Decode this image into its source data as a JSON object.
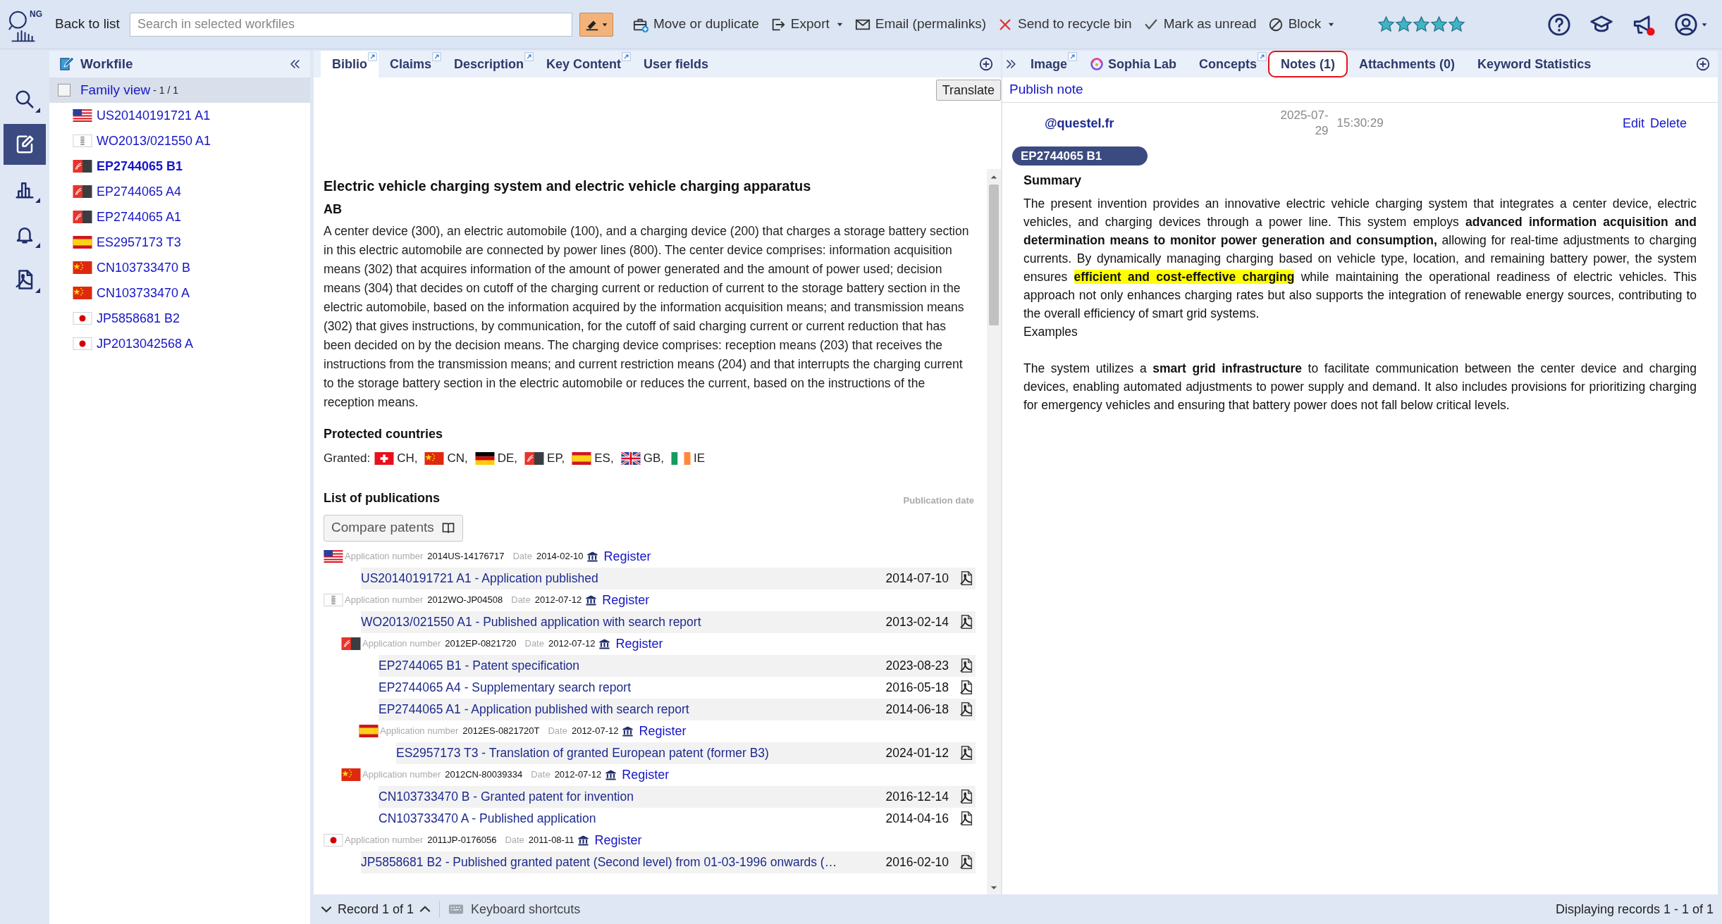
{
  "topbar": {
    "logo_text": "NG",
    "back": "Back to list",
    "search": {
      "placeholder": "Search in selected workfiles"
    },
    "actions": [
      {
        "kind": "move",
        "label": "Move or duplicate",
        "dropdown": false
      },
      {
        "kind": "export",
        "label": "Export",
        "dropdown": true
      },
      {
        "kind": "email",
        "label": "Email (permalinks)",
        "dropdown": false
      },
      {
        "kind": "recycle",
        "label": "Send to recycle bin",
        "dropdown": false
      },
      {
        "kind": "unread",
        "label": "Mark as unread",
        "dropdown": false
      },
      {
        "kind": "block",
        "label": "Block",
        "dropdown": true
      }
    ],
    "rating": {
      "stars": 5
    },
    "announcements_badge": true
  },
  "rail": [
    {
      "kind": "search",
      "selected": false
    },
    {
      "kind": "edit",
      "selected": true
    },
    {
      "kind": "chart",
      "selected": false
    },
    {
      "kind": "bell",
      "selected": false
    },
    {
      "kind": "pdf",
      "selected": false
    }
  ],
  "workfile": {
    "title": "Workfile",
    "family_view": {
      "label": "Family view",
      "count": "- 1 / 1",
      "checked": false
    },
    "items": [
      {
        "kind": "us",
        "label": "US20140191721 A1",
        "selected": false
      },
      {
        "kind": "wo",
        "label": "WO2013/021550 A1",
        "selected": false
      },
      {
        "kind": "ep",
        "label": "EP2744065 B1",
        "selected": true
      },
      {
        "kind": "ep",
        "label": "EP2744065 A4",
        "selected": false
      },
      {
        "kind": "ep",
        "label": "EP2744065 A1",
        "selected": false
      },
      {
        "kind": "es",
        "label": "ES2957173 T3",
        "selected": false
      },
      {
        "kind": "cn",
        "label": "CN103733470 B",
        "selected": false
      },
      {
        "kind": "cn",
        "label": "CN103733470 A",
        "selected": false
      },
      {
        "kind": "jp",
        "label": "JP5858681 B2",
        "selected": false
      },
      {
        "kind": "jp",
        "label": "JP2013042568 A",
        "selected": false
      }
    ]
  },
  "middle": {
    "tabs": [
      {
        "label": "Biblio",
        "selected": true,
        "popout": true
      },
      {
        "label": "Claims",
        "selected": false,
        "popout": true
      },
      {
        "label": "Description",
        "selected": false,
        "popout": true
      },
      {
        "label": "Key Content",
        "selected": false,
        "popout": true
      },
      {
        "label": "User fields",
        "selected": false,
        "popout": false
      }
    ],
    "translate": "Translate",
    "title": "Electric vehicle charging system and electric vehicle charging apparatus",
    "abstract_label": "AB",
    "abstract": "A center device (300), an electric automobile (100), and a charging device (200) that charges a storage battery section in this electric automobile are connected by power lines (800). The center device comprises: information acquisition means (302) that acquires information of the amount of power generated and the amount of power used; decision means (304) that decides on cutoff of the charging current or reduction of current to the storage battery section in the electric automobile, based on the information acquired by the information acquisition means; and transmission means (302) that gives instructions, by communication, for the cutoff of said charging current or current reduction that has been decided on by the decision means. The charging device comprises: reception means (203) that receives the instructions from the transmission means; and current restriction means (204) and that interrupts the charging current to the storage battery section in the electric automobile or reduces the current, based on the instructions of the reception means.",
    "protected": {
      "heading": "Protected countries",
      "label": "Granted:",
      "countries": [
        {
          "kind": "ch",
          "code": "CH,"
        },
        {
          "kind": "cn",
          "code": "CN,"
        },
        {
          "kind": "de",
          "code": "DE,"
        },
        {
          "kind": "ep",
          "code": "EP,"
        },
        {
          "kind": "es",
          "code": "ES,"
        },
        {
          "kind": "gb",
          "code": "GB,"
        },
        {
          "kind": "ie",
          "code": "IE"
        }
      ]
    },
    "publications": {
      "heading": "List of publications",
      "date_heading": "Publication date",
      "compare": "Compare patents",
      "applications": [
        {
          "kind": "us",
          "number_label": "Application number",
          "number": "2014US-14176717",
          "date_label": "Date",
          "date": "2014-02-10",
          "register": "Register",
          "publications": [
            {
              "title": "US20140191721 A1 - Application published",
              "date": "2014-07-10"
            }
          ]
        },
        {
          "kind": "wo",
          "number_label": "Application number",
          "number": "2012WO-JP04508",
          "date_label": "Date",
          "date": "2012-07-12",
          "register": "Register",
          "publications": [
            {
              "title": "WO2013/021550 A1 - Published application with search report",
              "date": "2013-02-14"
            }
          ],
          "children": [
            {
              "kind": "ep",
              "number_label": "Application number",
              "number": "2012EP-0821720",
              "date_label": "Date",
              "date": "2012-07-12",
              "register": "Register",
              "publications": [
                {
                  "title": "EP2744065 B1 - Patent specification",
                  "date": "2023-08-23"
                },
                {
                  "title": "EP2744065 A4 - Supplementary search report",
                  "date": "2016-05-18"
                },
                {
                  "title": "EP2744065 A1 - Application published with search report",
                  "date": "2014-06-18"
                }
              ],
              "children": [
                {
                  "kind": "es",
                  "number_label": "Application number",
                  "number": "2012ES-0821720T",
                  "date_label": "Date",
                  "date": "2012-07-12",
                  "register": "Register",
                  "publications": [
                    {
                      "title": "ES2957173 T3 - Translation of granted European patent (former B3)",
                      "date": "2024-01-12"
                    }
                  ]
                }
              ]
            },
            {
              "kind": "cn",
              "number_label": "Application number",
              "number": "2012CN-80039334",
              "date_label": "Date",
              "date": "2012-07-12",
              "register": "Register",
              "publications": [
                {
                  "title": "CN103733470 B - Granted patent for invention",
                  "date": "2016-12-14"
                },
                {
                  "title": "CN103733470 A - Published application",
                  "date": "2014-04-16"
                }
              ]
            }
          ]
        },
        {
          "kind": "jp",
          "number_label": "Application number",
          "number": "2011JP-0176056",
          "date_label": "Date",
          "date": "2011-08-11",
          "register": "Register",
          "publications": [
            {
              "title": "JP5858681 B2 - Published granted patent (Second level) from 01-03-1996 onwards (…",
              "date": "2016-02-10"
            }
          ]
        }
      ]
    }
  },
  "right": {
    "tabs": [
      {
        "label": "Image",
        "selected": false,
        "popout": true,
        "kind": "plain"
      },
      {
        "label": "Sophia Lab",
        "selected": false,
        "popout": false,
        "kind": "sophia"
      },
      {
        "label": "Concepts",
        "selected": false,
        "popout": true,
        "kind": "plain"
      },
      {
        "label": "Notes (1)",
        "selected": true,
        "popout": false,
        "kind": "plain"
      },
      {
        "label": "Attachments (0)",
        "selected": false,
        "popout": false,
        "kind": "plain"
      },
      {
        "label": "Keyword Statistics",
        "selected": false,
        "popout": false,
        "kind": "plain"
      }
    ],
    "publish": "Publish note",
    "note": {
      "author": "@questel.fr",
      "date": "2025-07-29",
      "time": "15:30:29",
      "edit": "Edit",
      "delete": "Delete",
      "badge": "EP2744065 B1",
      "heading": "Summary",
      "paragraphs": [
        {
          "segments": [
            {
              "kind": "plain",
              "text": "The present invention provides an innovative electric vehicle charging system that integrates a center device, electric vehicles, and charging devices through a power line. This system employs "
            },
            {
              "kind": "bold",
              "text": "advanced information acquisition and determination means to monitor power generation and consumption,"
            },
            {
              "kind": "plain",
              "text": " allowing for real-time adjustments to charging currents. By dynamically managing charging based on vehicle type, location, and remaining battery power, the system ensures "
            },
            {
              "kind": "highlight",
              "text": "efficient and cost-effective charging"
            },
            {
              "kind": "plain",
              "text": " while maintaining the operational readiness of electric vehicles. This approach not only enhances charging rates but also supports the integration of renewable energy sources, contributing to the overall efficiency of smart grid systems."
            }
          ]
        },
        {
          "segments": [
            {
              "kind": "plain",
              "text": "Examples"
            }
          ]
        },
        {
          "segments": [
            {
              "kind": "plain",
              "text": "The system utilizes a "
            },
            {
              "kind": "bold",
              "text": "smart grid infrastructure"
            },
            {
              "kind": "plain",
              "text": " to facilitate communication between the center device and charging devices, enabling automated adjustments to power supply and demand. It also includes provisions for prioritizing charging for emergency vehicles and ensuring that battery power does not fall below critical levels."
            }
          ]
        }
      ]
    }
  },
  "bottom": {
    "record": "Record 1 of 1",
    "shortcuts": "Keyboard shortcuts",
    "displaying": "Displaying records 1 - 1 of 1"
  }
}
